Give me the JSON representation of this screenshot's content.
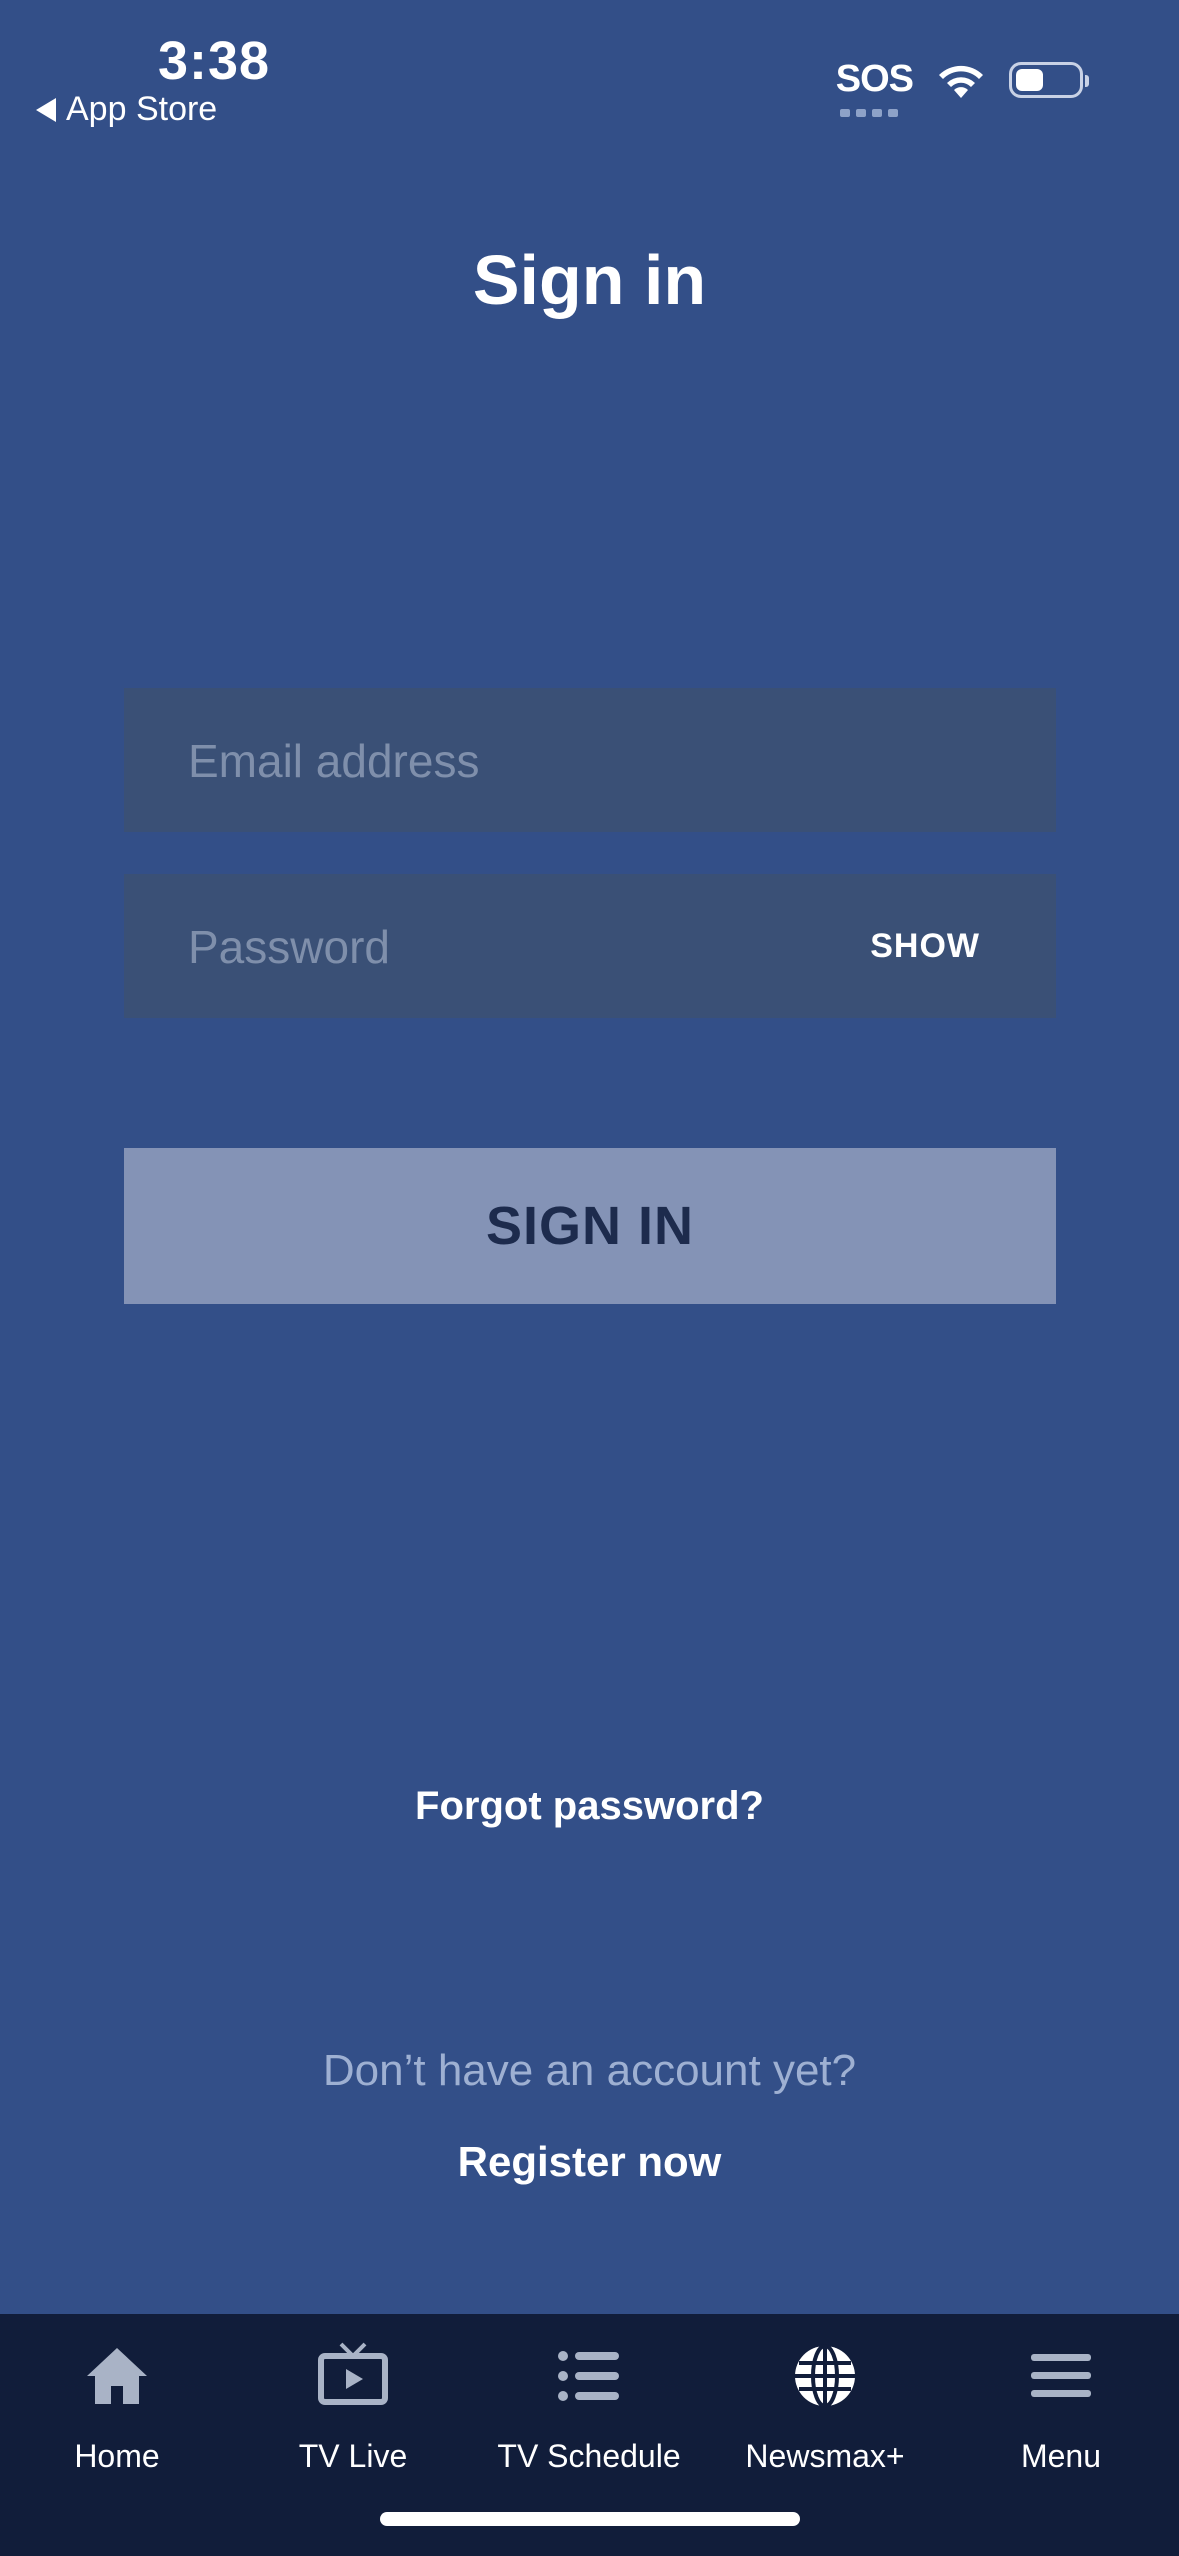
{
  "status_bar": {
    "time": "3:38",
    "back_label": "App Store",
    "sos": "SOS",
    "battery_level": 0.45
  },
  "title": "Sign in",
  "form": {
    "email_placeholder": "Email address",
    "email_value": "",
    "password_placeholder": "Password",
    "password_value": "",
    "show_label": "SHOW",
    "submit_label": "SIGN IN"
  },
  "forgot_label": "Forgot password?",
  "no_account_text": "Don’t have an account yet?",
  "register_label": "Register now",
  "tabbar": {
    "items": [
      {
        "label": "Home",
        "icon": "home-icon"
      },
      {
        "label": "TV Live",
        "icon": "tv-icon"
      },
      {
        "label": "TV Schedule",
        "icon": "list-icon"
      },
      {
        "label": "Newsmax+",
        "icon": "globe-icon"
      },
      {
        "label": "Menu",
        "icon": "hamburger-icon"
      }
    ]
  },
  "colors": {
    "background": "#334f88",
    "input_background": "#3a5076",
    "button_background": "#8493b6",
    "button_text": "#1d2b4d",
    "tabbar_background": "#111d3a"
  }
}
